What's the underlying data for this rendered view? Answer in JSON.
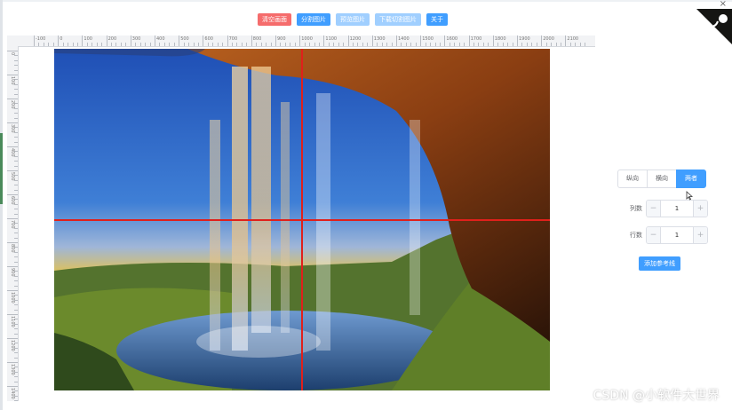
{
  "toolbar": {
    "buttons": [
      {
        "label": "清空画面",
        "color": "#f56c6c"
      },
      {
        "label": "分割图片",
        "color": "#409eff"
      },
      {
        "label": "预览图片",
        "color": "#a0cfff"
      },
      {
        "label": "下载切割图片",
        "color": "#a0cfff"
      },
      {
        "label": "关于",
        "color": "#409eff"
      }
    ]
  },
  "ruler": {
    "top_labels": [
      "-100",
      "0",
      "100",
      "200",
      "300",
      "400",
      "500",
      "600",
      "700",
      "800",
      "900",
      "1000",
      "1100",
      "1200",
      "1300",
      "1400",
      "1500",
      "1600",
      "1700",
      "1800",
      "1900",
      "2000",
      "2100"
    ],
    "left_labels": [
      "0",
      "100",
      "200",
      "300",
      "400",
      "500",
      "600",
      "700",
      "800",
      "900",
      "1000",
      "1100",
      "1200",
      "1300",
      "1400"
    ]
  },
  "panel": {
    "direction_options": [
      "纵向",
      "横向",
      "两者"
    ],
    "selected_direction": "两者",
    "columns_label": "列数",
    "columns_value": "1",
    "rows_label": "行数",
    "rows_value": "1",
    "minus_symbol": "−",
    "plus_symbol": "+",
    "add_button": "添加参考线"
  },
  "window": {
    "close_symbol": "×"
  },
  "watermark": "CSDN @小软件大世界",
  "colors": {
    "accent": "#409eff",
    "danger": "#f56c6c",
    "guide": "#e0201b"
  }
}
